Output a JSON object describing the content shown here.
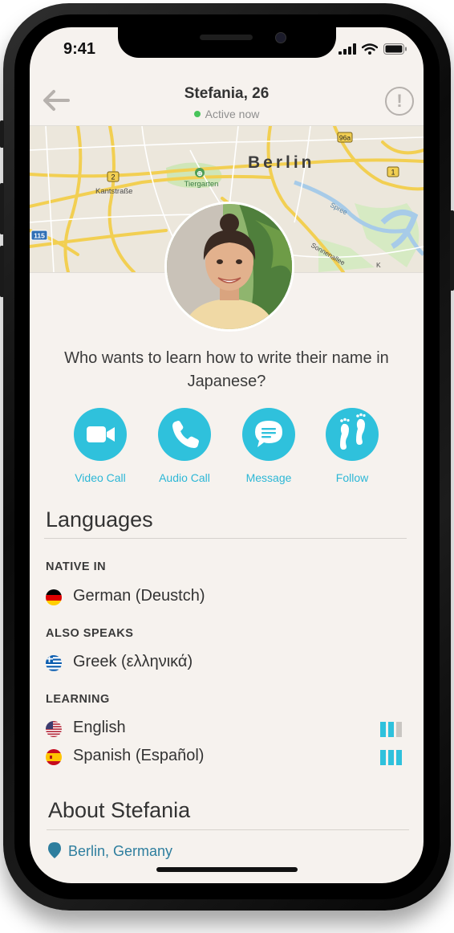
{
  "status_bar": {
    "time": "9:41"
  },
  "header": {
    "title": "Stefania, 26",
    "status": "Active now",
    "status_color": "#48c45a",
    "back_icon": "arrow-left-icon",
    "report_icon": "exclamation-circle-icon",
    "report_label": "!"
  },
  "map": {
    "city_label": "Berlin",
    "labels": [
      "Tiergarten",
      "Kantstraße",
      "Spree",
      "Sonnenallee",
      "K"
    ],
    "road_markers": [
      "2",
      "96a",
      "1",
      "115"
    ]
  },
  "profile": {
    "bio": "Who wants to learn how to write their name in Japanese?"
  },
  "actions": [
    {
      "label": "Video Call",
      "icon": "video-camera-icon"
    },
    {
      "label": "Audio Call",
      "icon": "phone-icon"
    },
    {
      "label": "Message",
      "icon": "chat-bubble-icon"
    },
    {
      "label": "Follow",
      "icon": "footprints-icon"
    }
  ],
  "accent_color": "#2fc1dc",
  "languages": {
    "title": "Languages",
    "native_heading": "NATIVE IN",
    "native": [
      {
        "name": "German (Deustch)",
        "flag": "germany-flag-icon"
      }
    ],
    "also_heading": "ALSO SPEAKS",
    "also": [
      {
        "name": "Greek (ελληνικά)",
        "flag": "greece-flag-icon"
      }
    ],
    "learning_heading": "LEARNING",
    "learning": [
      {
        "name": "English",
        "flag": "usa-flag-icon",
        "level": 2,
        "max_level": 3
      },
      {
        "name": "Spanish (Español)",
        "flag": "spain-flag-icon",
        "level": 3,
        "max_level": 3
      }
    ]
  },
  "about": {
    "title": "About Stefania",
    "location": "Berlin, Germany",
    "location_icon": "map-pin-icon"
  }
}
